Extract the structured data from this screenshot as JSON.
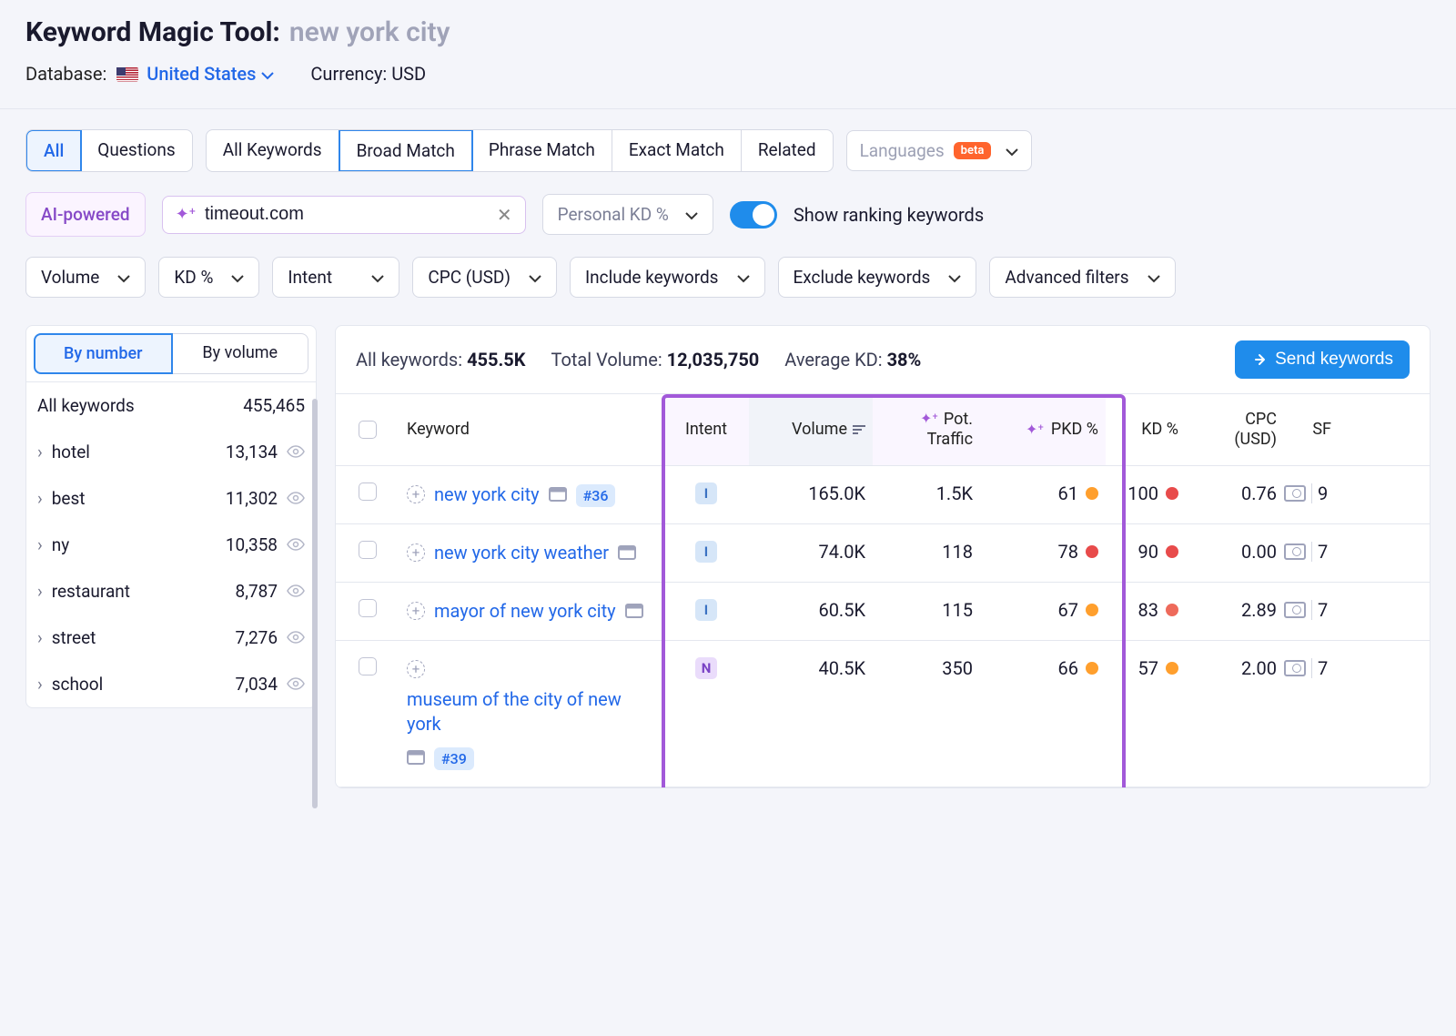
{
  "header": {
    "title": "Keyword Magic Tool:",
    "query": "new york city",
    "database_label": "Database:",
    "database_value": "United States",
    "currency_label": "Currency: USD"
  },
  "tabs1": {
    "all": "All",
    "questions": "Questions"
  },
  "tabs2": {
    "all_kw": "All Keywords",
    "broad": "Broad Match",
    "phrase": "Phrase Match",
    "exact": "Exact Match",
    "related": "Related"
  },
  "languages": {
    "label": "Languages",
    "beta": "beta"
  },
  "ai": {
    "badge": "AI-powered",
    "domain": "timeout.com"
  },
  "pkd_filter": "Personal KD %",
  "toggle_label": "Show ranking keywords",
  "filters": {
    "volume": "Volume",
    "kd": "KD %",
    "intent": "Intent",
    "cpc": "CPC (USD)",
    "include": "Include keywords",
    "exclude": "Exclude keywords",
    "advanced": "Advanced filters"
  },
  "sidebar": {
    "by_number": "By number",
    "by_volume": "By volume",
    "all_keywords": "All keywords",
    "all_count": "455,465",
    "items": [
      {
        "label": "hotel",
        "count": "13,134"
      },
      {
        "label": "best",
        "count": "11,302"
      },
      {
        "label": "ny",
        "count": "10,358"
      },
      {
        "label": "restaurant",
        "count": "8,787"
      },
      {
        "label": "street",
        "count": "7,276"
      },
      {
        "label": "school",
        "count": "7,034"
      }
    ]
  },
  "summary": {
    "all_kw_label": "All keywords:",
    "all_kw_val": "455.5K",
    "total_vol_label": "Total Volume:",
    "total_vol_val": "12,035,750",
    "avg_kd_label": "Average KD:",
    "avg_kd_val": "38%",
    "send": "Send keywords"
  },
  "cols": {
    "keyword": "Keyword",
    "intent": "Intent",
    "volume": "Volume",
    "pot1": "Pot.",
    "pot2": "Traffic",
    "pkd": "PKD %",
    "kd": "KD %",
    "cpc1": "CPC",
    "cpc2": "(USD)",
    "sf": "SF"
  },
  "rows": [
    {
      "kw": "new york city",
      "rank": "#36",
      "intent": "I",
      "volume": "165.0K",
      "pot": "1.5K",
      "pkd": "61",
      "pkd_dot": "orange",
      "kd": "100",
      "kd_dot": "red",
      "cpc": "0.76",
      "sf": "9"
    },
    {
      "kw": "new york city weather",
      "rank": "",
      "intent": "I",
      "volume": "74.0K",
      "pot": "118",
      "pkd": "78",
      "pkd_dot": "red",
      "kd": "90",
      "kd_dot": "red",
      "cpc": "0.00",
      "sf": "7"
    },
    {
      "kw": "mayor of new york city",
      "rank": "",
      "intent": "I",
      "volume": "60.5K",
      "pot": "115",
      "pkd": "67",
      "pkd_dot": "orange",
      "kd": "83",
      "kd_dot": "red2",
      "cpc": "2.89",
      "sf": "7"
    },
    {
      "kw": "museum of the city of new york",
      "rank": "#39",
      "intent": "N",
      "volume": "40.5K",
      "pot": "350",
      "pkd": "66",
      "pkd_dot": "orange",
      "kd": "57",
      "kd_dot": "orange",
      "cpc": "2.00",
      "sf": "7"
    }
  ]
}
